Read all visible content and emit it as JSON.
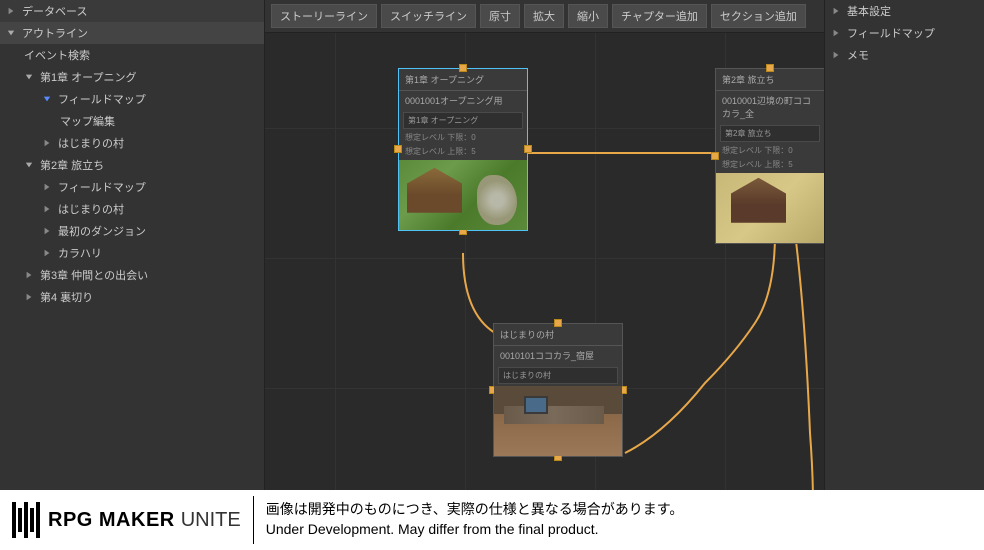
{
  "sidebar_left": {
    "database": "データベース",
    "outline": "アウトライン",
    "event_search": "イベント検索",
    "items": [
      {
        "label": "第1章 オープニング",
        "expanded": true,
        "children": [
          {
            "label": "フィールドマップ",
            "expanded": true,
            "children": [
              {
                "label": "マップ編集"
              }
            ]
          },
          {
            "label": "はじまりの村"
          }
        ]
      },
      {
        "label": "第2章 旅立ち",
        "expanded": true,
        "children": [
          {
            "label": "フィールドマップ"
          },
          {
            "label": "はじまりの村"
          },
          {
            "label": "最初のダンジョン"
          },
          {
            "label": "カラハリ"
          }
        ]
      },
      {
        "label": "第3章 仲間との出会い"
      },
      {
        "label": "第4 裏切り"
      }
    ]
  },
  "toolbar": {
    "storyline": "ストーリーライン",
    "switchline": "スイッチライン",
    "original": "原寸",
    "zoom_in": "拡大",
    "zoom_out": "縮小",
    "add_chapter": "チャプター追加",
    "add_section": "セクション追加"
  },
  "nodes": {
    "node1": {
      "title": "第1章 オープニング",
      "id": "0001001オープニング用",
      "field": "第1章 オープニング",
      "level_low": "想定レベル 下限：0",
      "level_high": "想定レベル 上限：5"
    },
    "node2": {
      "title": "第2章 旅立ち",
      "id": "0010001辺境の町ココカラ_全",
      "field": "第2章 旅立ち",
      "level_low": "想定レベル 下限：0",
      "level_high": "想定レベル 上限：5"
    },
    "node3": {
      "title": "はじまりの村",
      "id": "0010101ココカラ_宿屋",
      "field": "はじまりの村"
    }
  },
  "sidebar_right": {
    "basic_settings": "基本設定",
    "field_map": "フィールドマップ",
    "memo": "メモ"
  },
  "footer": {
    "logo_main": "RPG MAKER",
    "logo_sub": "UNITE",
    "note_jp": "画像は開発中のものにつき、実際の仕様と異なる場合があります。",
    "note_en": "Under Development. May differ from the final product."
  }
}
